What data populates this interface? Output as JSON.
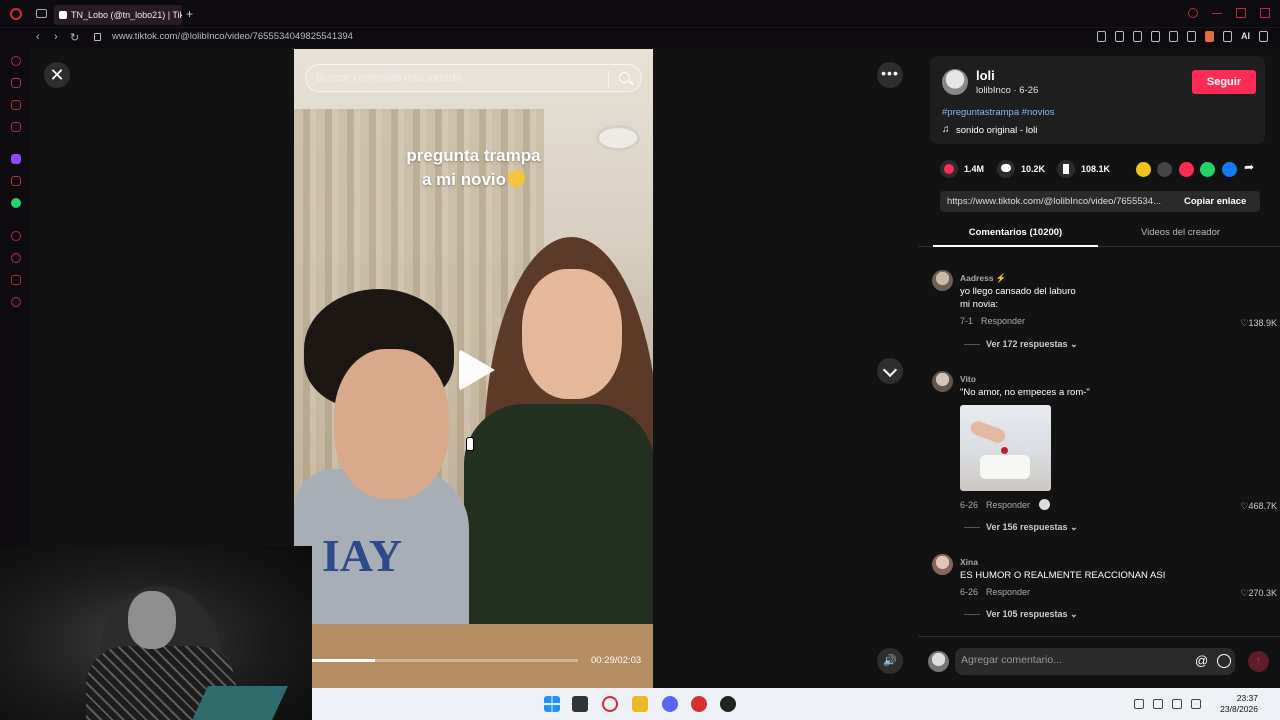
{
  "browser": {
    "tab_title": "TN_Lobo (@tn_lobo21) | Tik",
    "url": "www.tiktok.com/@lolibInco/video/7655534049825541394",
    "extension_ai_label": "AI"
  },
  "video": {
    "search_placeholder": "Buscar contenido relacionado",
    "overlay_text_line1": "pregunta trampa",
    "overlay_text_line2": "a mi novio",
    "time": "00:29/02:03",
    "progress_percent": 23.6,
    "close_label": "✕",
    "more_label": "•••",
    "volume_label": "🔊"
  },
  "creator": {
    "name": "loli",
    "handle_date": "lolibInco · 6-26",
    "follow_label": "Seguir",
    "hashtags": "#preguntastrampa #novios",
    "music": "sonido original - loli"
  },
  "actions": {
    "likes": "1.4M",
    "comments": "10.2K",
    "saves": "108.1K",
    "share_colors": [
      "#f1c21b",
      "#444444",
      "#fe2c55",
      "#25d366",
      "#1877f2"
    ]
  },
  "link": {
    "url": "https://www.tiktok.com/@lolibInco/video/7655534...",
    "copy_label": "Copiar enlace"
  },
  "tabs": {
    "comments": "Comentarios (10200)",
    "videos": "Videos del creador"
  },
  "comments": [
    {
      "user": "Aadress ⚡",
      "line1": "yo llego cansado del laburo",
      "line2": "mi novia:",
      "date": "7-1",
      "reply": "Responder",
      "likes": "138.9K",
      "replies": "Ver 172 respuestas"
    },
    {
      "user": "Vito",
      "line1": "\"No amor, no empeces a rom-\"",
      "date": "6-26",
      "reply": "Responder",
      "likes": "468.7K",
      "replies": "Ver 156 respuestas"
    },
    {
      "user": "Xina",
      "line1": "ES HUMOR O REALMENTE REACCIONAN ASI",
      "date": "6-26",
      "reply": "Responder",
      "likes": "270.3K",
      "replies": "Ver 105 respuestas"
    }
  ],
  "comment_input": {
    "placeholder": "Agregar comentario...",
    "at_label": "@"
  },
  "taskbar": {
    "time": "23:37",
    "date": "23/8/2026"
  }
}
